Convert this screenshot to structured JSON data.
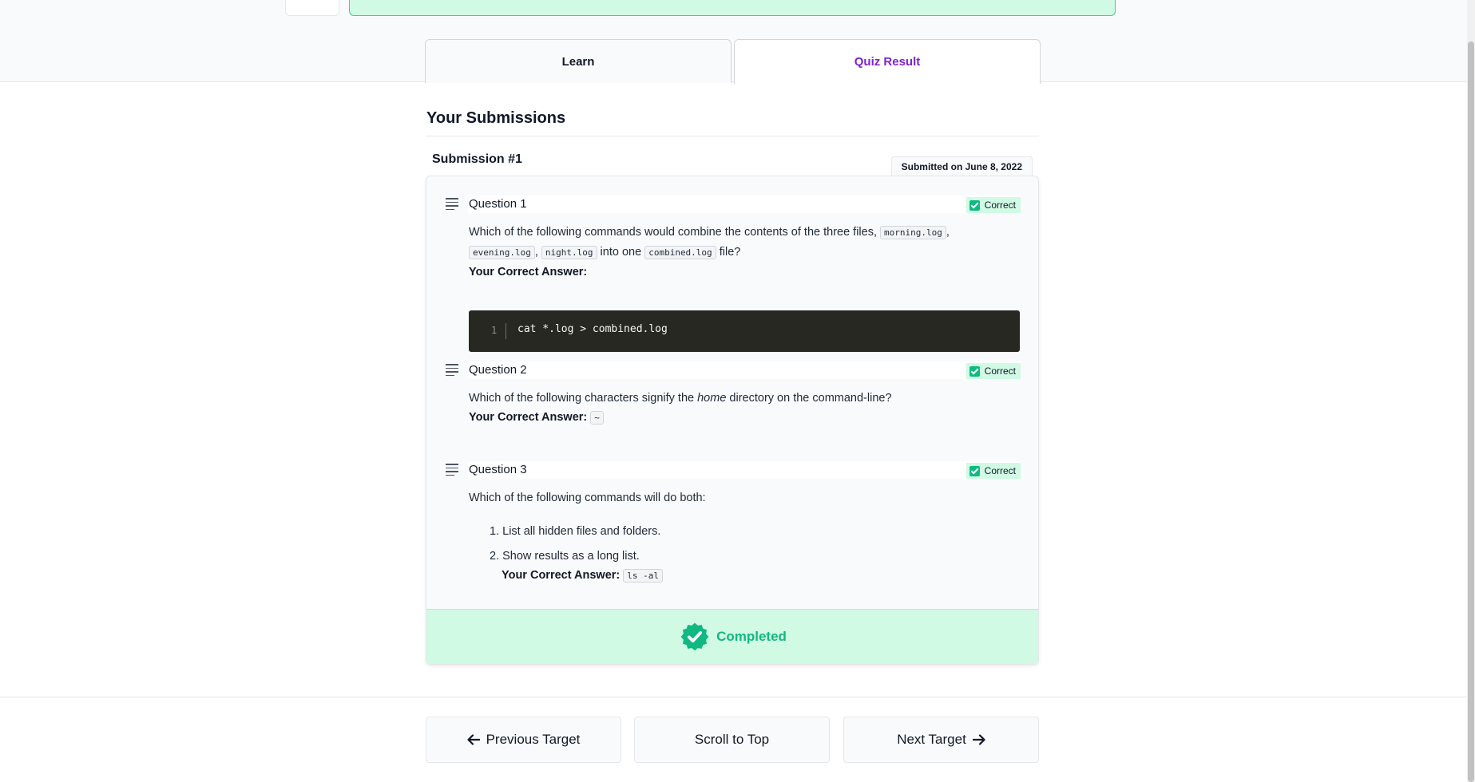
{
  "tabs": [
    {
      "label": "Learn"
    },
    {
      "label": "Quiz Result"
    }
  ],
  "section_title": "Your Submissions",
  "submission": {
    "title": "Submission #1",
    "date": "Submitted on June 8, 2022",
    "completed_label": "Completed"
  },
  "questions": [
    {
      "title": "Question 1",
      "status": "Correct",
      "text_before": "Which of the following commands would combine the contents of the three files, ",
      "files": [
        "morning.log",
        "evening.log",
        "night.log"
      ],
      "text_into": " into one ",
      "target": "combined.log",
      "text_after": " file?",
      "answer_label": "Your Correct Answer:",
      "code_line_number": "1",
      "code": "cat *.log > combined.log"
    },
    {
      "title": "Question 2",
      "status": "Correct",
      "text_before": "Which of the following characters signify the ",
      "text_em": "home",
      "text_after": " directory on the command-line?",
      "answer_label": "Your Correct Answer:",
      "answer_code": "~"
    },
    {
      "title": "Question 3",
      "status": "Correct",
      "text": "Which of the following commands will do both:",
      "items": [
        "List all hidden files and folders.",
        "Show results as a long list."
      ],
      "answer_label": "Your Correct Answer:",
      "answer_code": "ls -al"
    }
  ],
  "footer": {
    "prev_label": "Previous Target",
    "top_label": "Scroll to Top",
    "next_label": "Next Target"
  },
  "colors": {
    "accent_purple": "#7e22ce",
    "success_green": "#10b981",
    "success_bg": "#d1fae5",
    "code_bg": "#272822"
  },
  "icons": {
    "question": "list-lines-icon",
    "status": "checkbox-checked-icon",
    "completed": "verified-badge-icon",
    "prev": "arrow-left-icon",
    "next": "arrow-right-icon"
  }
}
